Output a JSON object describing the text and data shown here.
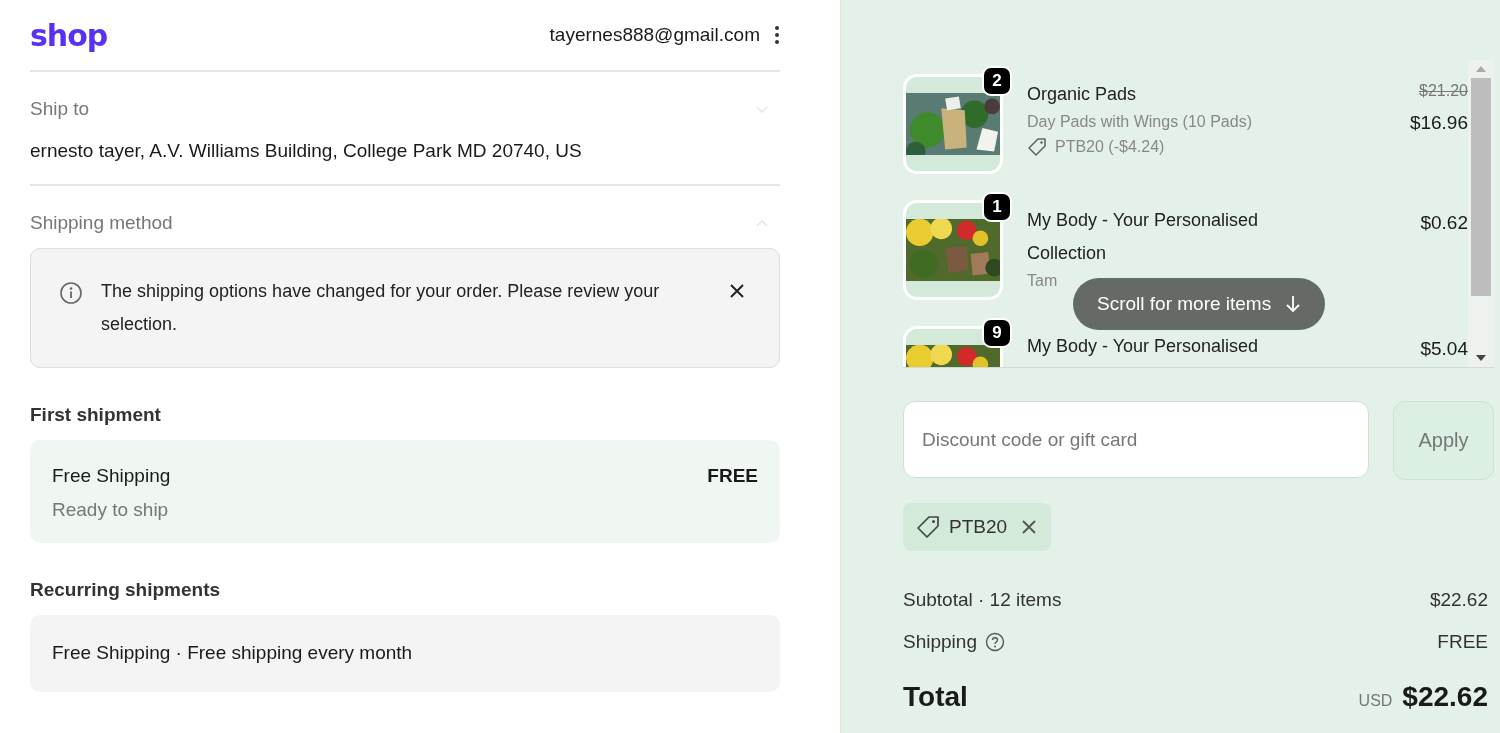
{
  "header": {
    "logo": "shop",
    "email": "tayernes888@gmail.com"
  },
  "ship_to": {
    "label": "Ship to",
    "value": "ernesto tayer, A.V. Williams Building, College Park MD 20740, US",
    "expanded": false
  },
  "shipping_method": {
    "label": "Shipping method",
    "expanded": true,
    "notice": "The shipping options have changed for your order. Please review your selection.",
    "groups": [
      {
        "heading": "First shipment",
        "option": {
          "name": "Free Shipping",
          "detail": "Ready to ship",
          "price": "FREE",
          "selected": true
        }
      },
      {
        "heading": "Recurring shipments",
        "option": {
          "name": "Free Shipping · Free shipping every month",
          "selected": false
        }
      }
    ]
  },
  "cart": {
    "items": [
      {
        "quantity": "2",
        "title": "Organic Pads",
        "variant": "Day Pads with Wings (10 Pads)",
        "discount": "PTB20 (-$4.24)",
        "compare_price": "$21.20",
        "price": "$16.96"
      },
      {
        "quantity": "1",
        "title": "My Body - Your Personalised Collection",
        "variant": "Tam",
        "price": "$0.62"
      },
      {
        "quantity": "9",
        "title": "My Body - Your Personalised",
        "price": "$5.04"
      }
    ],
    "scroll_hint": "Scroll for more items"
  },
  "discount": {
    "placeholder": "Discount code or gift card",
    "button": "Apply",
    "applied_codes": [
      "PTB20"
    ]
  },
  "summary": {
    "lines": [
      {
        "label": "Subtotal · 12 items",
        "value": "$22.62",
        "help": false
      },
      {
        "label": "Shipping",
        "value": "FREE",
        "help": true
      }
    ],
    "total": {
      "label": "Total",
      "currency": "USD",
      "value": "$22.62"
    }
  }
}
